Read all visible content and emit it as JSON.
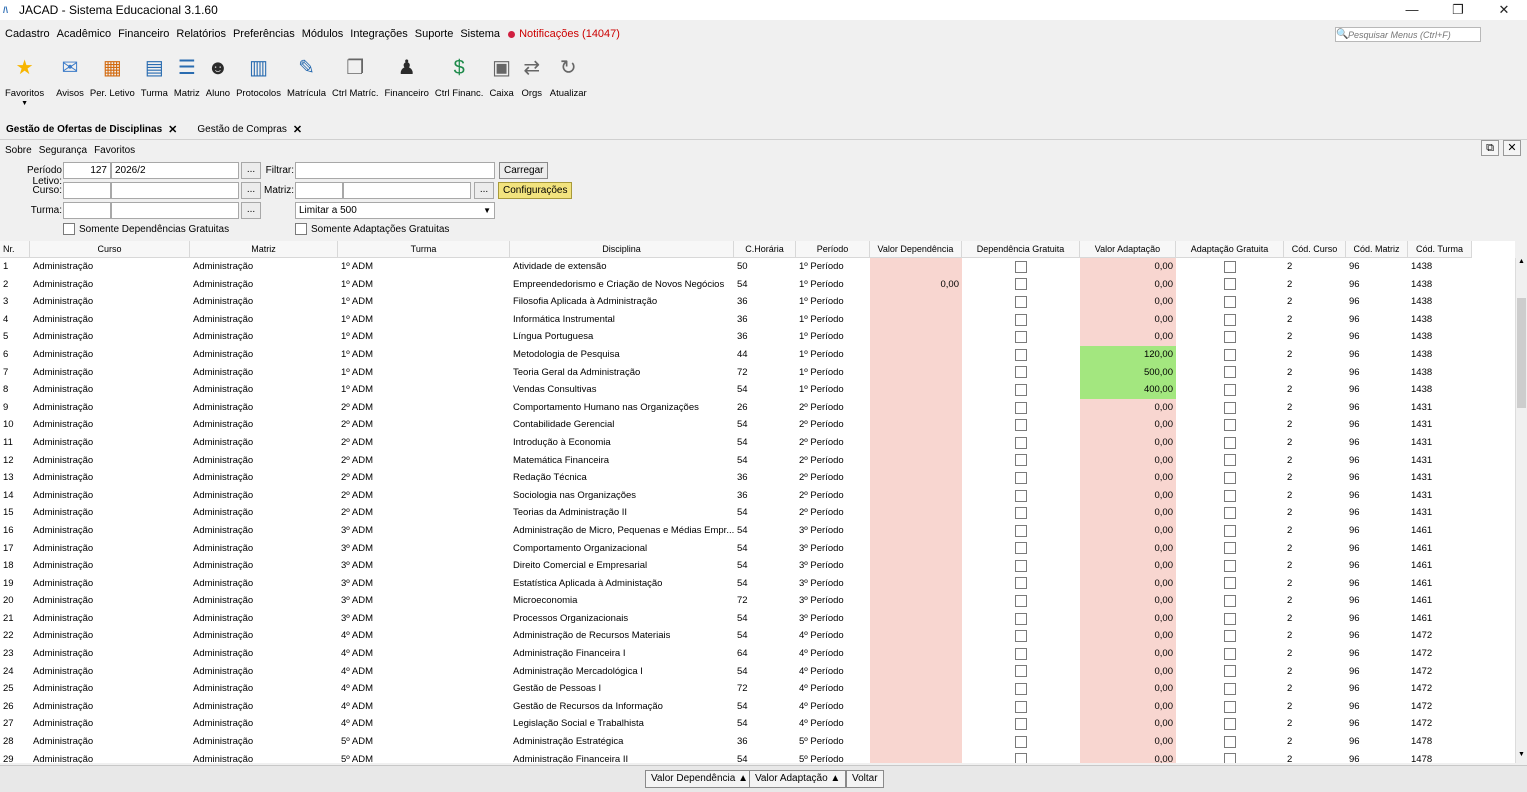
{
  "window": {
    "title": "JACAD - Sistema Educacional 3.1.60",
    "minimize": "—",
    "maximize": "❐",
    "close": "✕"
  },
  "menubar": {
    "items": [
      "Cadastro",
      "Acadêmico",
      "Financeiro",
      "Relatórios",
      "Preferências",
      "Módulos",
      "Integrações",
      "Suporte",
      "Sistema"
    ],
    "notifications": "Notificações (14047)",
    "search_placeholder": "Pesquisar Menus (Ctrl+F)"
  },
  "toolbar": [
    {
      "label": "Favoritos",
      "icon": "star-icon"
    },
    {
      "label": "Avisos",
      "icon": "mail-icon"
    },
    {
      "label": "Per. Letivo",
      "icon": "calendar-icon"
    },
    {
      "label": "Turma",
      "icon": "class-icon"
    },
    {
      "label": "Matriz",
      "icon": "matrix-icon"
    },
    {
      "label": "Aluno",
      "icon": "student-icon"
    },
    {
      "label": "Protocolos",
      "icon": "protocol-icon"
    },
    {
      "label": "Matrícula",
      "icon": "enrollment-icon"
    },
    {
      "label": "Ctrl Matríc.",
      "icon": "enrollment-control-icon"
    },
    {
      "label": "Financeiro",
      "icon": "finance-icon"
    },
    {
      "label": "Ctrl Financ.",
      "icon": "finance-control-icon"
    },
    {
      "label": "Caixa",
      "icon": "cash-register-icon"
    },
    {
      "label": "Orgs",
      "icon": "transfer-icon"
    },
    {
      "label": "Atualizar",
      "icon": "refresh-icon"
    }
  ],
  "tabs": [
    {
      "label": "Gestão de Ofertas de Disciplinas",
      "active": true
    },
    {
      "label": "Gestão de Compras",
      "active": false
    }
  ],
  "submenu": [
    "Sobre",
    "Segurança",
    "Favoritos"
  ],
  "filters": {
    "periodo_label": "Período Letivo:",
    "periodo_code": "127",
    "periodo_value": "2026/2",
    "filtrar_label": "Filtrar:",
    "filtrar_value": "",
    "carregar": "Carregar",
    "curso_label": "Curso:",
    "matriz_label": "Matriz:",
    "configuracoes": "Configurações",
    "turma_label": "Turma:",
    "limit": "Limitar a 500",
    "dots": "...",
    "dep_gratuitas": "Somente Dependências Gratuitas",
    "adapt_gratuitas": "Somente Adaptações Gratuitas"
  },
  "grid": {
    "headers": [
      "Nr.",
      "Curso",
      "Matriz",
      "Turma",
      "Disciplina",
      "C.Horária",
      "Período",
      "Valor Dependência",
      "Dependência Gratuita",
      "Valor Adaptação",
      "Adaptação Gratuita",
      "Cód. Curso",
      "Cód. Matriz",
      "Cód. Turma"
    ],
    "rows": [
      {
        "nr": "1",
        "curso": "Administração",
        "matriz": "Administração",
        "turma": "1º ADM",
        "disc": "Atividade de extensão",
        "ch": "50",
        "per": "1º Período",
        "vdep": "",
        "vad": "0,00",
        "cc": "2",
        "cm": "96",
        "ct": "1438",
        "green": false
      },
      {
        "nr": "2",
        "curso": "Administração",
        "matriz": "Administração",
        "turma": "1º ADM",
        "disc": "Empreendedorismo e Criação de Novos Negócios",
        "ch": "54",
        "per": "1º Período",
        "vdep": "0,00",
        "vad": "0,00",
        "cc": "2",
        "cm": "96",
        "ct": "1438",
        "green": false
      },
      {
        "nr": "3",
        "curso": "Administração",
        "matriz": "Administração",
        "turma": "1º ADM",
        "disc": "Filosofia Aplicada à Administração",
        "ch": "36",
        "per": "1º Período",
        "vdep": "",
        "vad": "0,00",
        "cc": "2",
        "cm": "96",
        "ct": "1438",
        "green": false
      },
      {
        "nr": "4",
        "curso": "Administração",
        "matriz": "Administração",
        "turma": "1º ADM",
        "disc": "Informática Instrumental",
        "ch": "36",
        "per": "1º Período",
        "vdep": "",
        "vad": "0,00",
        "cc": "2",
        "cm": "96",
        "ct": "1438",
        "green": false
      },
      {
        "nr": "5",
        "curso": "Administração",
        "matriz": "Administração",
        "turma": "1º ADM",
        "disc": "Língua Portuguesa",
        "ch": "36",
        "per": "1º Período",
        "vdep": "",
        "vad": "0,00",
        "cc": "2",
        "cm": "96",
        "ct": "1438",
        "green": false
      },
      {
        "nr": "6",
        "curso": "Administração",
        "matriz": "Administração",
        "turma": "1º ADM",
        "disc": "Metodologia de Pesquisa",
        "ch": "44",
        "per": "1º Período",
        "vdep": "",
        "vad": "120,00",
        "cc": "2",
        "cm": "96",
        "ct": "1438",
        "green": true
      },
      {
        "nr": "7",
        "curso": "Administração",
        "matriz": "Administração",
        "turma": "1º ADM",
        "disc": "Teoria Geral da Administração",
        "ch": "72",
        "per": "1º Período",
        "vdep": "",
        "vad": "500,00",
        "cc": "2",
        "cm": "96",
        "ct": "1438",
        "green": true
      },
      {
        "nr": "8",
        "curso": "Administração",
        "matriz": "Administração",
        "turma": "1º ADM",
        "disc": "Vendas Consultivas",
        "ch": "54",
        "per": "1º Período",
        "vdep": "",
        "vad": "400,00",
        "cc": "2",
        "cm": "96",
        "ct": "1438",
        "green": true
      },
      {
        "nr": "9",
        "curso": "Administração",
        "matriz": "Administração",
        "turma": "2º ADM",
        "disc": "Comportamento Humano nas Organizações",
        "ch": "26",
        "per": "2º Período",
        "vdep": "",
        "vad": "0,00",
        "cc": "2",
        "cm": "96",
        "ct": "1431",
        "green": false
      },
      {
        "nr": "10",
        "curso": "Administração",
        "matriz": "Administração",
        "turma": "2º ADM",
        "disc": "Contabilidade Gerencial",
        "ch": "54",
        "per": "2º Período",
        "vdep": "",
        "vad": "0,00",
        "cc": "2",
        "cm": "96",
        "ct": "1431",
        "green": false
      },
      {
        "nr": "11",
        "curso": "Administração",
        "matriz": "Administração",
        "turma": "2º ADM",
        "disc": "Introdução à Economia",
        "ch": "54",
        "per": "2º Período",
        "vdep": "",
        "vad": "0,00",
        "cc": "2",
        "cm": "96",
        "ct": "1431",
        "green": false
      },
      {
        "nr": "12",
        "curso": "Administração",
        "matriz": "Administração",
        "turma": "2º ADM",
        "disc": "Matemática Financeira",
        "ch": "54",
        "per": "2º Período",
        "vdep": "",
        "vad": "0,00",
        "cc": "2",
        "cm": "96",
        "ct": "1431",
        "green": false
      },
      {
        "nr": "13",
        "curso": "Administração",
        "matriz": "Administração",
        "turma": "2º ADM",
        "disc": "Redação Técnica",
        "ch": "36",
        "per": "2º Período",
        "vdep": "",
        "vad": "0,00",
        "cc": "2",
        "cm": "96",
        "ct": "1431",
        "green": false
      },
      {
        "nr": "14",
        "curso": "Administração",
        "matriz": "Administração",
        "turma": "2º ADM",
        "disc": "Sociologia nas Organizações",
        "ch": "36",
        "per": "2º Período",
        "vdep": "",
        "vad": "0,00",
        "cc": "2",
        "cm": "96",
        "ct": "1431",
        "green": false
      },
      {
        "nr": "15",
        "curso": "Administração",
        "matriz": "Administração",
        "turma": "2º ADM",
        "disc": "Teorias da Administração II",
        "ch": "54",
        "per": "2º Período",
        "vdep": "",
        "vad": "0,00",
        "cc": "2",
        "cm": "96",
        "ct": "1431",
        "green": false
      },
      {
        "nr": "16",
        "curso": "Administração",
        "matriz": "Administração",
        "turma": "3º ADM",
        "disc": "Administração de Micro, Pequenas e Médias Empr...",
        "ch": "54",
        "per": "3º Período",
        "vdep": "",
        "vad": "0,00",
        "cc": "2",
        "cm": "96",
        "ct": "1461",
        "green": false
      },
      {
        "nr": "17",
        "curso": "Administração",
        "matriz": "Administração",
        "turma": "3º ADM",
        "disc": "Comportamento Organizacional",
        "ch": "54",
        "per": "3º Período",
        "vdep": "",
        "vad": "0,00",
        "cc": "2",
        "cm": "96",
        "ct": "1461",
        "green": false
      },
      {
        "nr": "18",
        "curso": "Administração",
        "matriz": "Administração",
        "turma": "3º ADM",
        "disc": "Direito Comercial e Empresarial",
        "ch": "54",
        "per": "3º Período",
        "vdep": "",
        "vad": "0,00",
        "cc": "2",
        "cm": "96",
        "ct": "1461",
        "green": false
      },
      {
        "nr": "19",
        "curso": "Administração",
        "matriz": "Administração",
        "turma": "3º ADM",
        "disc": "Estatística Aplicada à Administação",
        "ch": "54",
        "per": "3º Período",
        "vdep": "",
        "vad": "0,00",
        "cc": "2",
        "cm": "96",
        "ct": "1461",
        "green": false
      },
      {
        "nr": "20",
        "curso": "Administração",
        "matriz": "Administração",
        "turma": "3º ADM",
        "disc": "Microeconomia",
        "ch": "72",
        "per": "3º Período",
        "vdep": "",
        "vad": "0,00",
        "cc": "2",
        "cm": "96",
        "ct": "1461",
        "green": false
      },
      {
        "nr": "21",
        "curso": "Administração",
        "matriz": "Administração",
        "turma": "3º ADM",
        "disc": "Processos Organizacionais",
        "ch": "54",
        "per": "3º Período",
        "vdep": "",
        "vad": "0,00",
        "cc": "2",
        "cm": "96",
        "ct": "1461",
        "green": false
      },
      {
        "nr": "22",
        "curso": "Administração",
        "matriz": "Administração",
        "turma": "4º ADM",
        "disc": "Administração de Recursos Materiais",
        "ch": "54",
        "per": "4º Período",
        "vdep": "",
        "vad": "0,00",
        "cc": "2",
        "cm": "96",
        "ct": "1472",
        "green": false
      },
      {
        "nr": "23",
        "curso": "Administração",
        "matriz": "Administração",
        "turma": "4º ADM",
        "disc": "Administração Financeira I",
        "ch": "64",
        "per": "4º Período",
        "vdep": "",
        "vad": "0,00",
        "cc": "2",
        "cm": "96",
        "ct": "1472",
        "green": false
      },
      {
        "nr": "24",
        "curso": "Administração",
        "matriz": "Administração",
        "turma": "4º ADM",
        "disc": "Administração Mercadológica I",
        "ch": "54",
        "per": "4º Período",
        "vdep": "",
        "vad": "0,00",
        "cc": "2",
        "cm": "96",
        "ct": "1472",
        "green": false
      },
      {
        "nr": "25",
        "curso": "Administração",
        "matriz": "Administração",
        "turma": "4º ADM",
        "disc": "Gestão de Pessoas I",
        "ch": "72",
        "per": "4º Período",
        "vdep": "",
        "vad": "0,00",
        "cc": "2",
        "cm": "96",
        "ct": "1472",
        "green": false
      },
      {
        "nr": "26",
        "curso": "Administração",
        "matriz": "Administração",
        "turma": "4º ADM",
        "disc": "Gestão de Recursos da Informação",
        "ch": "54",
        "per": "4º Período",
        "vdep": "",
        "vad": "0,00",
        "cc": "2",
        "cm": "96",
        "ct": "1472",
        "green": false
      },
      {
        "nr": "27",
        "curso": "Administração",
        "matriz": "Administração",
        "turma": "4º ADM",
        "disc": "Legislação Social e Trabalhista",
        "ch": "54",
        "per": "4º Período",
        "vdep": "",
        "vad": "0,00",
        "cc": "2",
        "cm": "96",
        "ct": "1472",
        "green": false
      },
      {
        "nr": "28",
        "curso": "Administração",
        "matriz": "Administração",
        "turma": "5º ADM",
        "disc": "Administração Estratégica",
        "ch": "36",
        "per": "5º Período",
        "vdep": "",
        "vad": "0,00",
        "cc": "2",
        "cm": "96",
        "ct": "1478",
        "green": false
      },
      {
        "nr": "29",
        "curso": "Administração",
        "matriz": "Administração",
        "turma": "5º ADM",
        "disc": "Administração Financeira II",
        "ch": "54",
        "per": "5º Período",
        "vdep": "",
        "vad": "0,00",
        "cc": "2",
        "cm": "96",
        "ct": "1478",
        "green": false
      }
    ]
  },
  "footer": {
    "valor_dependencia": "Valor Dependência ▲",
    "valor_adaptacao": "Valor Adaptação ▲",
    "voltar": "Voltar"
  },
  "colors": {
    "value_cell": "#f8d6d0",
    "value_cell_highlight": "#a3e77f",
    "config_button": "#f2e37e"
  }
}
